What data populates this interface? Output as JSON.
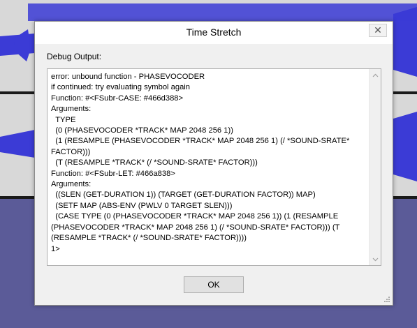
{
  "window": {
    "title": "Time Stretch",
    "close_label": "✕"
  },
  "debug": {
    "label": "Debug Output:",
    "text": "error: unbound function - PHASEVOCODER\nif continued: try evaluating symbol again\nFunction: #<FSubr-CASE: #466d388>\nArguments:\n  TYPE\n  (0 (PHASEVOCODER *TRACK* MAP 2048 256 1))\n  (1 (RESAMPLE (PHASEVOCODER *TRACK* MAP 2048 256 1) (/ *SOUND-SRATE* FACTOR)))\n  (T (RESAMPLE *TRACK* (/ *SOUND-SRATE* FACTOR)))\nFunction: #<FSubr-LET: #466a838>\nArguments:\n  ((SLEN (GET-DURATION 1)) (TARGET (GET-DURATION FACTOR)) MAP)\n  (SETF MAP (ABS-ENV (PWLV 0 TARGET SLEN)))\n  (CASE TYPE (0 (PHASEVOCODER *TRACK* MAP 2048 256 1)) (1 (RESAMPLE (PHASEVOCODER *TRACK* MAP 2048 256 1) (/ *SOUND-SRATE* FACTOR))) (T (RESAMPLE *TRACK* (/ *SOUND-SRATE* FACTOR))))\n1>"
  },
  "buttons": {
    "ok_label": "OK"
  },
  "icons": {
    "scroll_up": "chevron-up-icon",
    "scroll_down": "chevron-down-icon",
    "resize": "resize-grip-icon"
  },
  "colors": {
    "waveform": "#3e3edc",
    "track_background": "#5a5a9a",
    "selection_background": "#d4d4d4",
    "dialog_background": "#f0f0f0"
  }
}
